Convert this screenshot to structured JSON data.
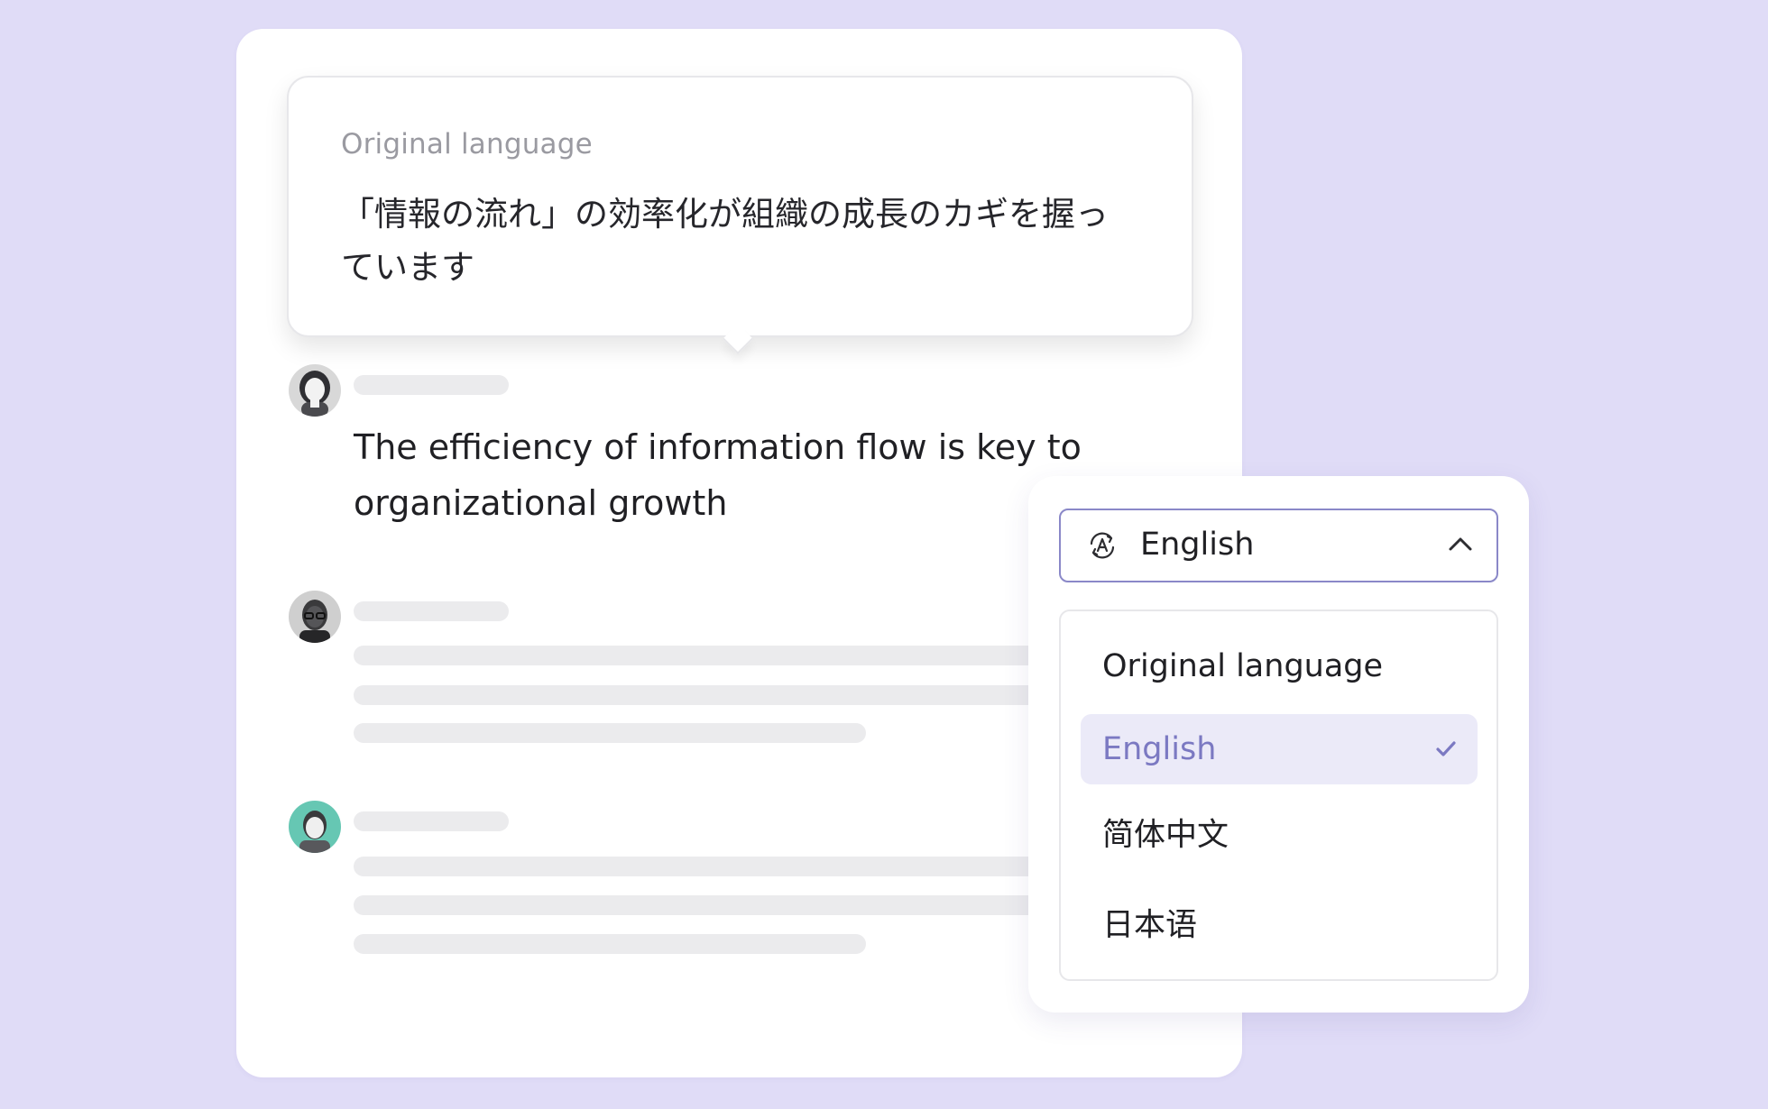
{
  "original_panel": {
    "label": "Original language",
    "text": "「情報の流れ」の効率化が組織の成長のカギを握っています"
  },
  "messages": [
    {
      "avatar": "avatar-woman",
      "text": "The efficiency of information flow is key to organizational growth"
    },
    {
      "avatar": "avatar-man-glasses",
      "text": ""
    },
    {
      "avatar": "avatar-man-green-background",
      "text": ""
    }
  ],
  "language_selector": {
    "selected_value": "English",
    "icon": "translate-icon",
    "chevron": "chevron-up-icon",
    "options": [
      {
        "label": "Original language",
        "selected": false
      },
      {
        "label": "English",
        "selected": true
      },
      {
        "label": "简体中文",
        "selected": false
      },
      {
        "label": "日本语",
        "selected": false
      }
    ]
  },
  "colors": {
    "background": "#e0dcf7",
    "accent": "#7b79c2",
    "selected_bg": "#ebeaf8",
    "skeleton": "#ebebed"
  }
}
